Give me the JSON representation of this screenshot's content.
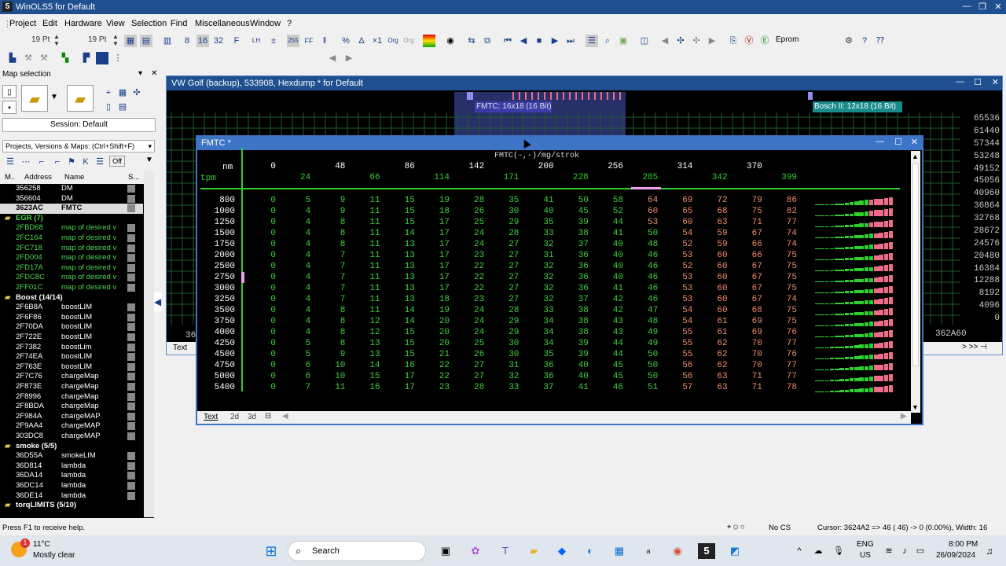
{
  "app": {
    "title": "WinOLS5 for Default",
    "icon": "5"
  },
  "menu": [
    "Project",
    "Edit",
    "Hardware",
    "View",
    "Selection",
    "Find",
    "Miscellaneous",
    "Window",
    "?"
  ],
  "toolbar": {
    "font_size_1": "19 Pt",
    "font_size_2": "19 Pt",
    "eprom_label": "Eprom",
    "off_label": "Off"
  },
  "left_panel": {
    "title": "Map selection",
    "session": "Session: Default",
    "projects_placeholder": "Projects, Versions & Maps: (Ctrl+Shift+F)",
    "columns": [
      "M..",
      "Address",
      "Name",
      "S..."
    ],
    "rows": [
      {
        "addr": "356258",
        "name": "DM",
        "type": "item"
      },
      {
        "addr": "356604",
        "name": "DM",
        "type": "item"
      },
      {
        "addr": "3623AC",
        "name": "FMTC",
        "type": "selected"
      },
      {
        "addr": "EGR (7)",
        "name": "",
        "type": "group-green"
      },
      {
        "addr": "2FBD68",
        "name": "map of desired v",
        "type": "green"
      },
      {
        "addr": "2FC164",
        "name": "map of desired v",
        "type": "green"
      },
      {
        "addr": "2FC718",
        "name": "map of desired v",
        "type": "green"
      },
      {
        "addr": "2FD004",
        "name": "map of desired v",
        "type": "green"
      },
      {
        "addr": "2FD17A",
        "name": "map of desired v",
        "type": "green"
      },
      {
        "addr": "2FDC8C",
        "name": "map of desired v",
        "type": "green"
      },
      {
        "addr": "2FF01C",
        "name": "map of desired v",
        "type": "green"
      },
      {
        "addr": "Boost (14/14)",
        "name": "",
        "type": "group"
      },
      {
        "addr": "2F6B8A",
        "name": "boostLIM",
        "type": "item"
      },
      {
        "addr": "2F6F86",
        "name": "boostLIM",
        "type": "item"
      },
      {
        "addr": "2F70DA",
        "name": "boostLIM",
        "type": "item"
      },
      {
        "addr": "2F722E",
        "name": "boostLIM",
        "type": "item"
      },
      {
        "addr": "2F7382",
        "name": "boostLim",
        "type": "item"
      },
      {
        "addr": "2F74EA",
        "name": "boostLIM",
        "type": "item"
      },
      {
        "addr": "2F763E",
        "name": "boostLIM",
        "type": "item"
      },
      {
        "addr": "2F7C76",
        "name": "chargeMap",
        "type": "item"
      },
      {
        "addr": "2F873E",
        "name": "chargeMap",
        "type": "item"
      },
      {
        "addr": "2F8996",
        "name": "chargeMap",
        "type": "item"
      },
      {
        "addr": "2F8BDA",
        "name": "chargeMap",
        "type": "item"
      },
      {
        "addr": "2F984A",
        "name": "chargeMAP",
        "type": "item"
      },
      {
        "addr": "2F9AA4",
        "name": "chargeMAP",
        "type": "item"
      },
      {
        "addr": "303DC8",
        "name": "chargeMAP",
        "type": "item"
      },
      {
        "addr": "smoke (5/5)",
        "name": "",
        "type": "group"
      },
      {
        "addr": "36D55A",
        "name": "smokeLIM",
        "type": "item"
      },
      {
        "addr": "36D814",
        "name": "lambda",
        "type": "item"
      },
      {
        "addr": "36DA14",
        "name": "lambda",
        "type": "item"
      },
      {
        "addr": "36DC14",
        "name": "lambda",
        "type": "item"
      },
      {
        "addr": "36DE14",
        "name": "lambda",
        "type": "item"
      },
      {
        "addr": "torqLIMITS (5/10)",
        "name": "",
        "type": "group"
      }
    ]
  },
  "hex_window": {
    "title": "VW Golf (backup), 533908, Hexdump * for Default",
    "tag_fmtc": "FMTC: 16x18 (16 Bit)",
    "tag_bosch": "Bosch II: 12x18 (16 Bit)",
    "right_values": [
      "65536",
      "61440",
      "57344",
      "53248",
      "49152",
      "45056",
      "40960",
      "36864",
      "32768",
      "28672",
      "24576",
      "20480",
      "16384",
      "12288",
      "8192",
      "4096",
      "0"
    ],
    "bottom_addr": "362A60",
    "bottom_left": "36",
    "text_tab": "Text"
  },
  "fmtc_window": {
    "title": "FMTC *",
    "map_title": "FMTC(-,-)/mg/strok",
    "axis_x_label": "nm",
    "axis_y_label": "tpm",
    "x_axis": [
      "0",
      "24",
      "48",
      "66",
      "86",
      "114",
      "142",
      "171",
      "200",
      "228",
      "256",
      "285",
      "314",
      "342",
      "370",
      "399"
    ],
    "y_axis": [
      "800",
      "1000",
      "1250",
      "1500",
      "1750",
      "2000",
      "2500",
      "2750",
      "3000",
      "3250",
      "3500",
      "3750",
      "4000",
      "4250",
      "4500",
      "4750",
      "5000",
      "5400"
    ],
    "values": [
      [
        0,
        5,
        9,
        11,
        15,
        19,
        28,
        35,
        41,
        50,
        58,
        64,
        69,
        72,
        79,
        86
      ],
      [
        0,
        4,
        9,
        11,
        15,
        18,
        26,
        30,
        40,
        45,
        52,
        60,
        65,
        68,
        75,
        82
      ],
      [
        0,
        4,
        8,
        11,
        15,
        17,
        25,
        29,
        35,
        39,
        44,
        53,
        60,
        63,
        71,
        77
      ],
      [
        0,
        4,
        8,
        11,
        14,
        17,
        24,
        28,
        33,
        38,
        41,
        50,
        54,
        59,
        67,
        74
      ],
      [
        0,
        4,
        8,
        11,
        13,
        17,
        24,
        27,
        32,
        37,
        40,
        48,
        52,
        59,
        66,
        74
      ],
      [
        0,
        4,
        7,
        11,
        13,
        17,
        23,
        27,
        31,
        36,
        40,
        46,
        53,
        60,
        66,
        75
      ],
      [
        0,
        4,
        7,
        11,
        13,
        17,
        22,
        27,
        32,
        36,
        40,
        46,
        52,
        60,
        67,
        75
      ],
      [
        0,
        4,
        7,
        11,
        13,
        17,
        22,
        27,
        32,
        36,
        40,
        46,
        53,
        60,
        67,
        75
      ],
      [
        0,
        4,
        7,
        11,
        13,
        17,
        22,
        27,
        32,
        36,
        41,
        46,
        53,
        60,
        67,
        75
      ],
      [
        0,
        4,
        7,
        11,
        13,
        18,
        23,
        27,
        32,
        37,
        42,
        46,
        53,
        60,
        67,
        74
      ],
      [
        0,
        4,
        8,
        11,
        14,
        19,
        24,
        28,
        33,
        38,
        42,
        47,
        54,
        60,
        68,
        75
      ],
      [
        0,
        4,
        8,
        12,
        14,
        20,
        24,
        29,
        34,
        38,
        43,
        48,
        54,
        61,
        69,
        75
      ],
      [
        0,
        4,
        8,
        12,
        15,
        20,
        24,
        29,
        34,
        38,
        43,
        49,
        55,
        61,
        69,
        76
      ],
      [
        0,
        5,
        8,
        13,
        15,
        20,
        25,
        30,
        34,
        39,
        44,
        49,
        55,
        62,
        70,
        77
      ],
      [
        0,
        5,
        9,
        13,
        15,
        21,
        26,
        30,
        35,
        39,
        44,
        50,
        55,
        62,
        70,
        76
      ],
      [
        0,
        6,
        10,
        14,
        16,
        22,
        27,
        31,
        36,
        40,
        45,
        50,
        56,
        62,
        70,
        77
      ],
      [
        0,
        6,
        10,
        15,
        17,
        22,
        27,
        32,
        36,
        40,
        45,
        50,
        56,
        63,
        71,
        77
      ],
      [
        0,
        7,
        11,
        16,
        17,
        23,
        28,
        33,
        37,
        41,
        46,
        51,
        57,
        63,
        71,
        78
      ]
    ],
    "tabs": [
      "Text",
      "2d",
      "3d"
    ]
  },
  "status": {
    "help": "Press F1 to receive help.",
    "cs": "No CS",
    "cursor": "Cursor: 3624A2 => 46 ( 46) -> 0 (0.00%), Width: 16"
  },
  "taskbar": {
    "weather_temp": "11°C",
    "weather_desc": "Mostly clear",
    "search_label": "Search",
    "lang": "ENG",
    "region": "US",
    "time": "8:00 PM",
    "date": "26/09/2024",
    "notif_count": "1"
  }
}
